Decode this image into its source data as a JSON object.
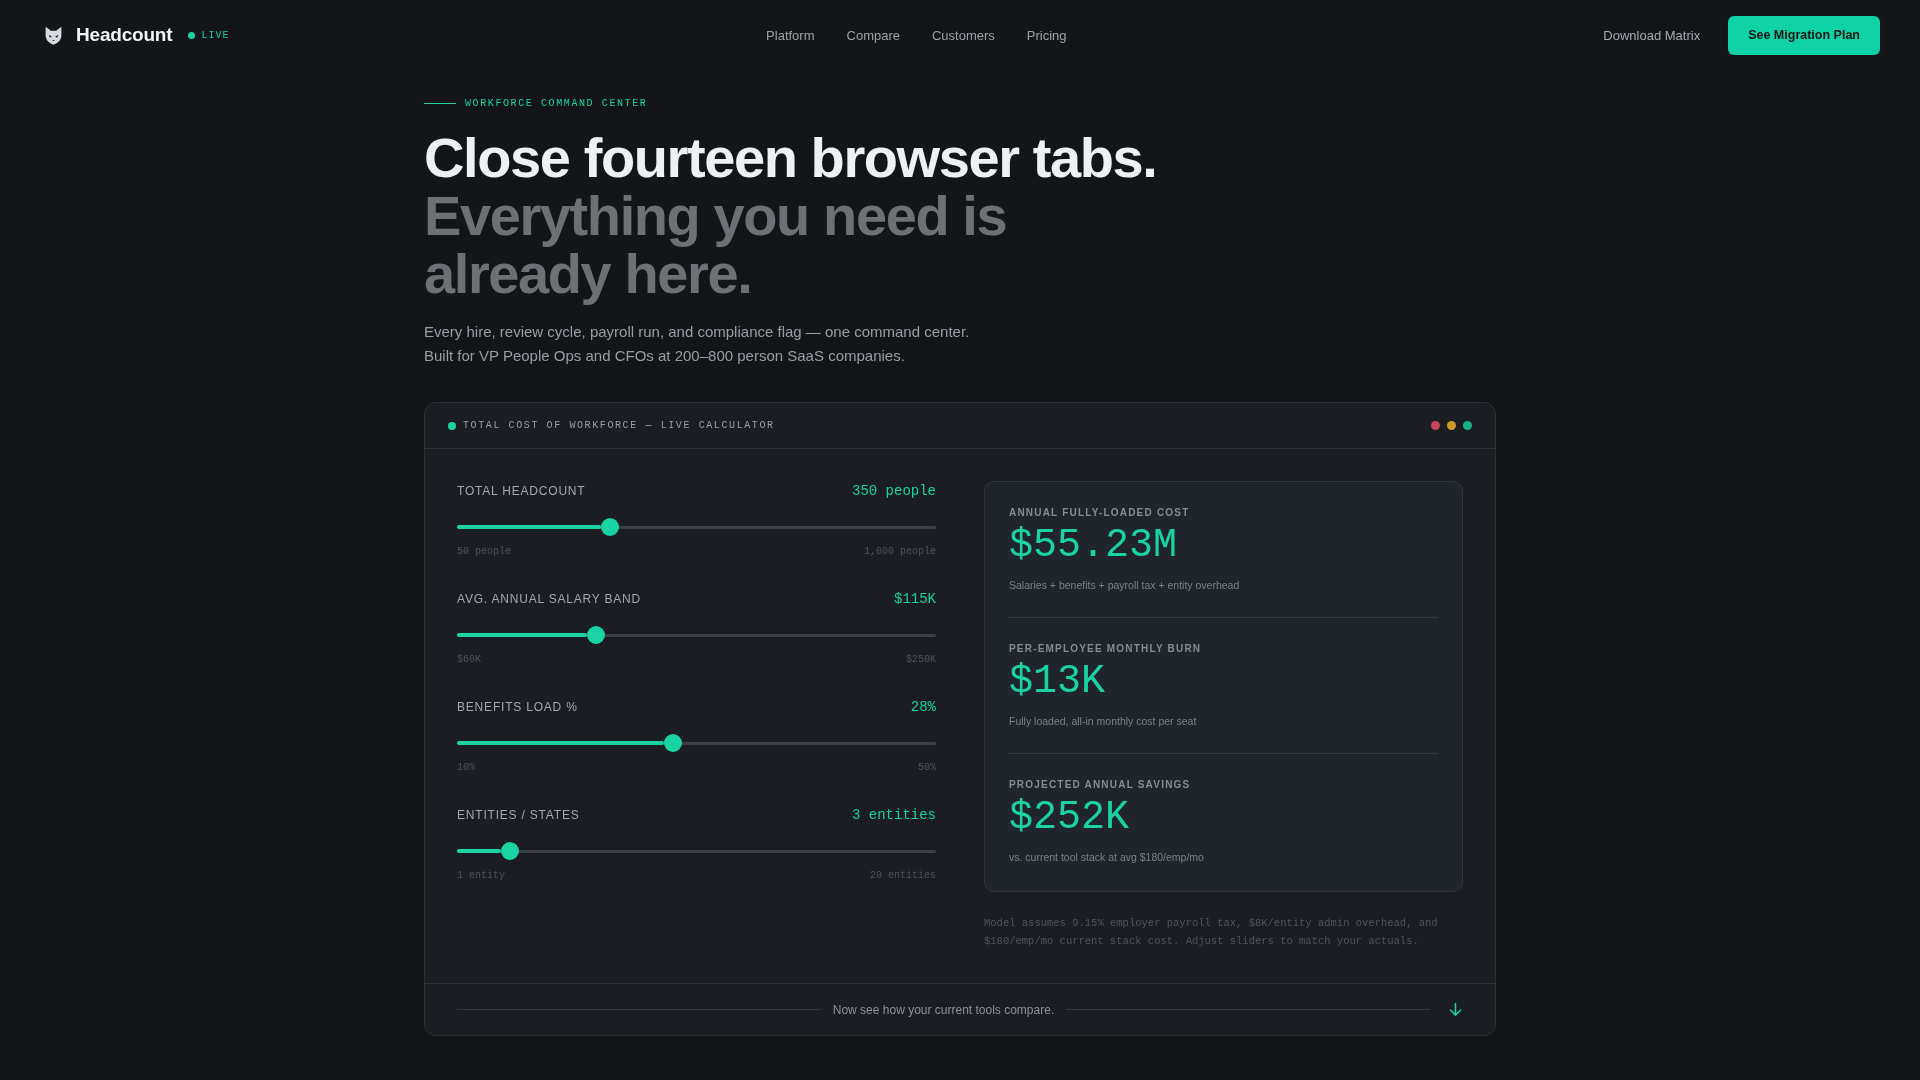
{
  "nav": {
    "brand": "Headcount",
    "status": "LIVE",
    "links": [
      "Platform",
      "Compare",
      "Customers",
      "Pricing"
    ],
    "secondary_link": "Download Matrix",
    "cta": "See Migration Plan"
  },
  "hero": {
    "eyebrow": "WORKFORCE COMMAND CENTER",
    "headline": "Close fourteen browser tabs.",
    "headline_muted": "Everything you need is already here.",
    "subtitle_lines": [
      "Every hire, review cycle, payroll run, and compliance flag — one command center.",
      "Built for VP People Ops and CFOs at 200–800 person SaaS companies."
    ]
  },
  "calculator": {
    "title": "TOTAL COST OF WORKFORCE — LIVE CALCULATOR",
    "window_dots": [
      {
        "color": "#c8445f"
      },
      {
        "color": "#d19a2b"
      },
      {
        "color": "#17b28c"
      }
    ],
    "sliders": [
      {
        "label": "TOTAL HEADCOUNT",
        "value": "350 people",
        "level": 0.32,
        "min_label": "50 people",
        "max_label": "1,000 people"
      },
      {
        "label": "AVG. ANNUAL SALARY BAND",
        "value": "$115K",
        "level": 0.29,
        "min_label": "$60K",
        "max_label": "$250K"
      },
      {
        "label": "BENEFITS LOAD %",
        "value": "28%",
        "level": 0.45,
        "min_label": "10%",
        "max_label": "50%"
      },
      {
        "label": "ENTITIES / STATES",
        "value": "3 entities",
        "level": 0.11,
        "min_label": "1 entity",
        "max_label": "20 entities"
      }
    ],
    "metrics": [
      {
        "label": "ANNUAL FULLY-LOADED COST",
        "value": "$55.23M",
        "note": "Salaries + benefits + payroll tax + entity overhead"
      },
      {
        "label": "PER-EMPLOYEE MONTHLY BURN",
        "value": "$13K",
        "note": "Fully loaded, all-in monthly cost per seat"
      },
      {
        "label": "PROJECTED ANNUAL SAVINGS",
        "value": "$252K",
        "note": "vs. current tool stack at avg $180/emp/mo"
      }
    ],
    "footnote": "Model assumes 9.15% employer payroll tax, $8K/entity admin overhead, and $180/emp/mo current stack cost. Adjust sliders to match your actuals.",
    "footer_text": "Now see how your current tools compare."
  }
}
